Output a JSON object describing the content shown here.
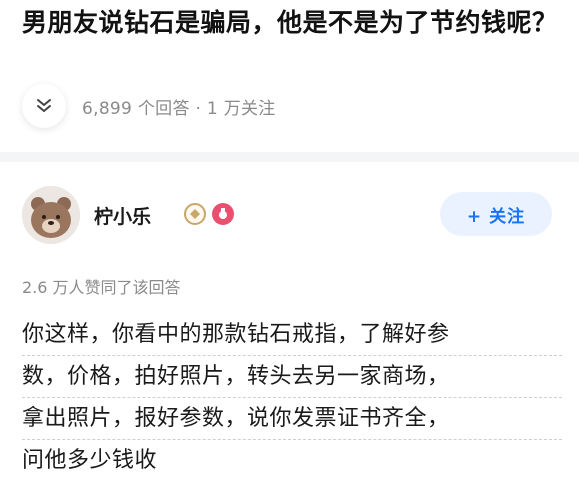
{
  "question": {
    "title": "男朋友说钻石是骗局，他是不是为了节约钱呢？",
    "meta": "6,899 个回答 · 1 万关注"
  },
  "answer": {
    "author": {
      "name": "柠小乐",
      "follow_label": "+ 关注"
    },
    "likes": "2.6 万人赞同了该回答",
    "lines": [
      "你这样，你看中的那款钻石戒指，了解好参",
      "数，价格，拍好照片，转头去另一家商场，",
      "拿出照片，报好参数，说你发票证书齐全，",
      "问他多少钱收"
    ]
  },
  "colors": {
    "accent": "#1772f6",
    "follow_bg": "#ebf2ff",
    "meta_gray": "#8a8a8a",
    "divider": "#f4f5f7"
  },
  "icons": {
    "collapse": "double-chevron-down-icon",
    "badge_1": "creator-level-badge-icon",
    "badge_2": "medal-badge-icon"
  }
}
